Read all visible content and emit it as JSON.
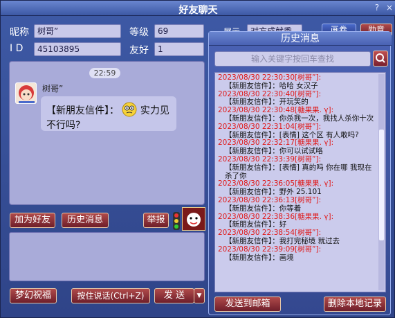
{
  "window": {
    "title": "好友聊天",
    "icons": [
      "?",
      "×"
    ]
  },
  "profile": {
    "nickname_label": "昵称",
    "nickname_value": "树哥”",
    "level_label": "等级",
    "level_value": "69",
    "id_label": "I D",
    "id_value": "45103895",
    "friendship_label": "友好",
    "friendship_value": "1",
    "show_label": "展示",
    "show_value": "对方成就秀",
    "right_btn1": "画卷",
    "right_btn2": "勋章"
  },
  "chat": {
    "time": "22:59",
    "sender": "树哥”",
    "message_prefix": "【新朋友信件】：",
    "message_suffix": "实力见不行吗?"
  },
  "buttons": {
    "add_friend": "加为好友",
    "history": "历史消息",
    "report": "举报",
    "dream_wish": "梦幻祝福",
    "voice": "按住说话(Ctrl+Z)",
    "send": "发 送"
  },
  "history": {
    "title": "历史消息",
    "search_placeholder": "输入关键字按回车查找",
    "send_mail": "发送到邮箱",
    "delete_local": "删除本地记录",
    "entries": [
      {
        "ts": "2023/08/30 22:30:30",
        "name": "[树哥”]:",
        "text": "【新朋友信件】：哈哈 女汉子"
      },
      {
        "ts": "2023/08/30 22:30:40",
        "name": "[树哥”]:",
        "text": "【新朋友信件】：开玩笑的"
      },
      {
        "ts": "2023/08/30 22:30:48",
        "name": "[糖果果. γ]:",
        "text": "【新朋友信件】：你杀我一次，我找人杀你十次"
      },
      {
        "ts": "2023/08/30 22:31:04",
        "name": "[树哥”]:",
        "text": "【新朋友信件】：[表情]  这个区  有人敢吗?"
      },
      {
        "ts": "2023/08/30 22:32:17",
        "name": "[糖果果. γ]:",
        "text": "【新朋友信件】：你可以试试咯"
      },
      {
        "ts": "2023/08/30 22:33:39",
        "name": "[树哥”]:",
        "text": "【新朋友信件】：[表情] 真的吗  你在哪  我现在杀了你"
      },
      {
        "ts": "2023/08/30 22:36:05",
        "name": "[糖果果. γ]:",
        "text": "【新朋友信件】：野外    25.101"
      },
      {
        "ts": "2023/08/30 22:36:13",
        "name": "[树哥”]:",
        "text": "【新朋友信件】：你等着"
      },
      {
        "ts": "2023/08/30 22:38:36",
        "name": "[糖果果. γ]:",
        "text": "【新朋友信件】：好"
      },
      {
        "ts": "2023/08/30 22:38:54",
        "name": "[树哥”]:",
        "text": "【新朋友信件】：我打完秘境   就过去"
      },
      {
        "ts": "2023/08/30 22:39:09",
        "name": "[树哥”]:",
        "text": "【新朋友信件】：画境"
      }
    ]
  }
}
